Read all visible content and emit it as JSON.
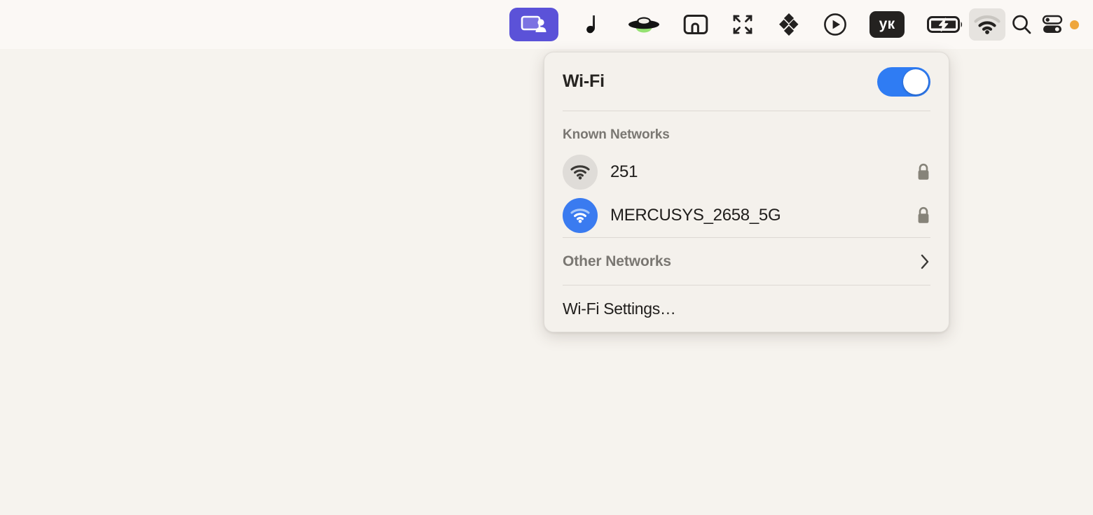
{
  "desktop": {
    "background": "#f6f3ee"
  },
  "menubar": {
    "background": "#fbf8f5",
    "items": [
      {
        "name": "screen-share-app-icon",
        "icon": "screen-share-icon",
        "label": "",
        "active": false,
        "tile_color": "#5b52d8"
      },
      {
        "name": "music-note-icon",
        "icon": "music-note-icon",
        "label": "",
        "active": false
      },
      {
        "name": "ufo-icon",
        "icon": "ufo-icon",
        "label": "",
        "active": false
      },
      {
        "name": "window-snap-icon",
        "icon": "window-snap-icon",
        "label": "",
        "active": false
      },
      {
        "name": "expand-arrows-icon",
        "icon": "expand-arrows-icon",
        "label": "",
        "active": false
      },
      {
        "name": "dropbox-icon",
        "icon": "dropbox-diamond-icon",
        "label": "",
        "active": false
      },
      {
        "name": "play-circle-icon",
        "icon": "play-circle-icon",
        "label": "",
        "active": false
      },
      {
        "name": "keyboard-layout-badge",
        "icon": "keyboard-layout-icon",
        "label": "ук",
        "active": false
      },
      {
        "name": "battery-charging-icon",
        "icon": "battery-charging-icon",
        "label": "",
        "active": false
      },
      {
        "name": "wifi-menu-icon",
        "icon": "wifi-icon",
        "label": "",
        "active": true
      },
      {
        "name": "spotlight-search-icon",
        "icon": "search-icon",
        "label": "",
        "active": false
      },
      {
        "name": "control-center-icon",
        "icon": "control-center-icon",
        "label": "",
        "active": false
      }
    ],
    "status_dot_color": "#efa63c"
  },
  "wifi_panel": {
    "title": "Wi-Fi",
    "toggle": {
      "on": true,
      "accent_color": "#2f7cf3"
    },
    "known_networks_label": "Known Networks",
    "networks": [
      {
        "ssid": "251",
        "connected": false,
        "secured": true,
        "icon": "wifi-icon",
        "lock_icon": "lock-icon",
        "icon_bg": "#dfdcd8"
      },
      {
        "ssid": "MERCUSYS_2658_5G",
        "connected": true,
        "secured": true,
        "icon": "wifi-icon",
        "lock_icon": "lock-icon",
        "icon_bg": "#3a7bf0"
      }
    ],
    "other_networks_label": "Other Networks",
    "other_networks_chevron": "chevron-right-icon",
    "settings_label": "Wi-Fi Settings…"
  }
}
